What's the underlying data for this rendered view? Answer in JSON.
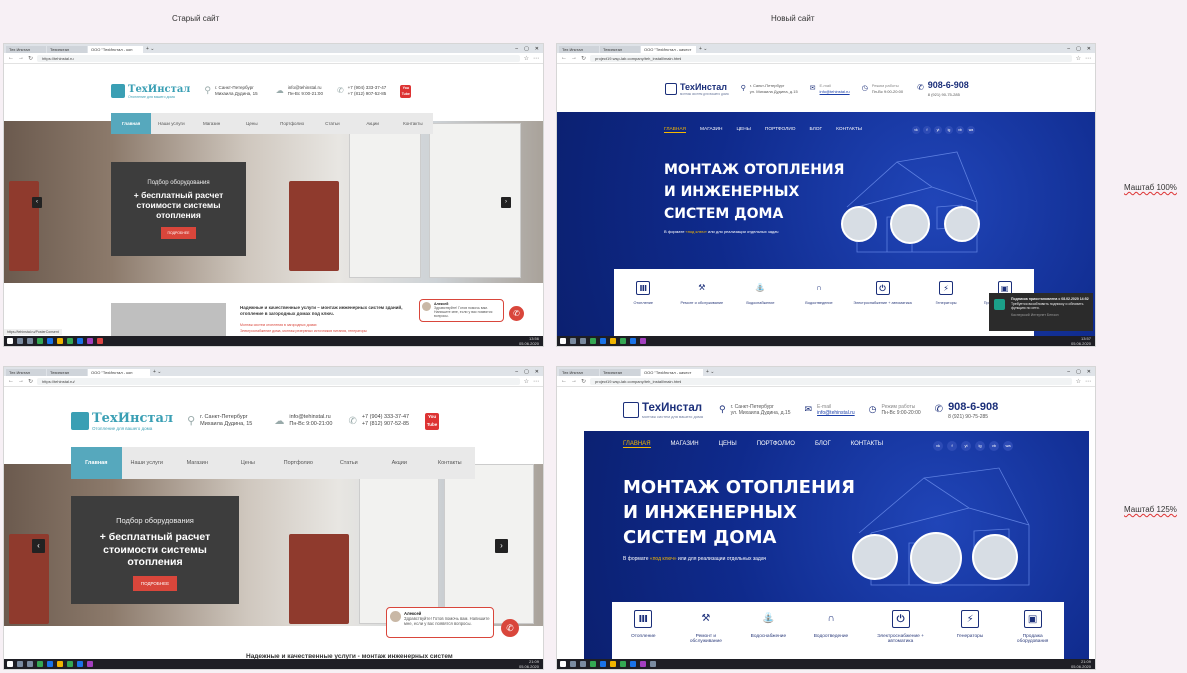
{
  "captions": {
    "old": "Старый сайт",
    "new": "Новый сайт",
    "zoom100": "Маштаб 100%",
    "zoom125": "Маштаб 125%"
  },
  "colors": {
    "old_accent": "#56a8bd",
    "old_button": "#d9463b",
    "new_primary": "#0f2a8c",
    "new_accent": "#f5b800"
  },
  "old": {
    "tab1": "Тех Инстал",
    "tab2": "Техинстал",
    "tab3": "ООО \"ТехИнстал - кон",
    "url_100": "https://tehinstal.ru",
    "url_125": "https://tehinstal.ru/",
    "brand": "ТехИнстал",
    "tagline": "Отопление для вашего дома",
    "city": "г. Санкт-Петербург",
    "street": "Михаила Дудина, 15",
    "email": "info@tehinstal.ru",
    "hours": "Пн-Вс 9:00-21:00",
    "phone1": "+7 (904) 333-37-47",
    "phone2": "+7 (812) 907-52-85",
    "youtube": "You Tube",
    "nav": [
      "Главная",
      "Наши услуги",
      "Магазин",
      "Цены",
      "Портфолио",
      "Статьи",
      "Акции",
      "Контакты"
    ],
    "hero_small": "Подбор оборудования",
    "hero_big": "+ бесплатный расчет стоимости системы отопления",
    "hero_btn": "ПОДРОБНЕЕ",
    "chat_name": "Алексей",
    "chat_msg": "Здравствуйте! Готов помочь вам. Напишите мне, если у вас появятся вопросы.",
    "below_title": "Надежные и качественные услуги – монтаж инженерных систем зданий, отопление в загородных домах под ключ.",
    "below_title_125": "Надежные и качественные услуги - монтаж инженерных систем",
    "below_item1": "Монтаж систем отопления в загородных домах",
    "below_item2": "Электроснабжение дома, монтаж резервных источников питания, генераторы",
    "status_url": "https://tehinstal.ru/PosterConsent",
    "time": "13:56",
    "date": "05.06.2020",
    "time125": "21:09"
  },
  "new": {
    "tab1": "Тех Инстал",
    "tab2": "Техинстал",
    "tab3": "ООО \"ТехИнстал - качест",
    "url": "project19.wsp-lab.company/teh_install/main.html",
    "brand": "ТехИнстал",
    "tagline": "монтаж систем для вашего дома",
    "city": "г. Санкт-Петербург",
    "street": "ул. Михаила Дудина, д.15",
    "email_label": "E-mail",
    "email": "info@tehinstal.ru",
    "hours_label": "Режим работы",
    "hours": "Пн-Вс 9:00-20:00",
    "phone_main": "908-6-908",
    "phone_alt": "8 (921) 90-75-285",
    "nav": [
      "ГЛАВНАЯ",
      "МАГАЗИН",
      "ЦЕНЫ",
      "ПОРТФОЛИО",
      "БЛОГ",
      "КОНТАКТЫ"
    ],
    "social": [
      "vk",
      "f",
      "yt",
      "ig",
      "vb",
      "wa"
    ],
    "hero_line1": "МОНТАЖ ОТОПЛЕНИЯ",
    "hero_line2": "И ИНЖЕНЕРНЫХ",
    "hero_line3": "СИСТЕМ ДОМА",
    "hero_sub_a": "В формате ",
    "hero_sub_b": "«под ключ»",
    "hero_sub_c": " или для реализации отдельных задач",
    "services": [
      {
        "label": "Отопление",
        "icon": "radiator-icon"
      },
      {
        "label": "Ремонт и обслуживание",
        "icon": "wrench-icon"
      },
      {
        "label": "Водоснабжение",
        "icon": "water-pipe-icon"
      },
      {
        "label": "Водоотведение",
        "icon": "drain-icon"
      },
      {
        "label": "Электроснабжение + автоматика",
        "icon": "socket-icon"
      },
      {
        "label": "Генераторы",
        "icon": "generator-icon"
      },
      {
        "label": "Продажа оборудования",
        "icon": "box-icon"
      }
    ],
    "notif_title": "Подписка приостановлена с 08.02.2020 14:52",
    "notif_body": "Требуется возобновить подписку и обновить функцию по сети.",
    "notif_foot": "Касперский Интернет Бензоп",
    "time": "13:57",
    "date": "05.06.2020",
    "time125": "21:09"
  },
  "taskbar": {
    "lang": "РУС"
  }
}
